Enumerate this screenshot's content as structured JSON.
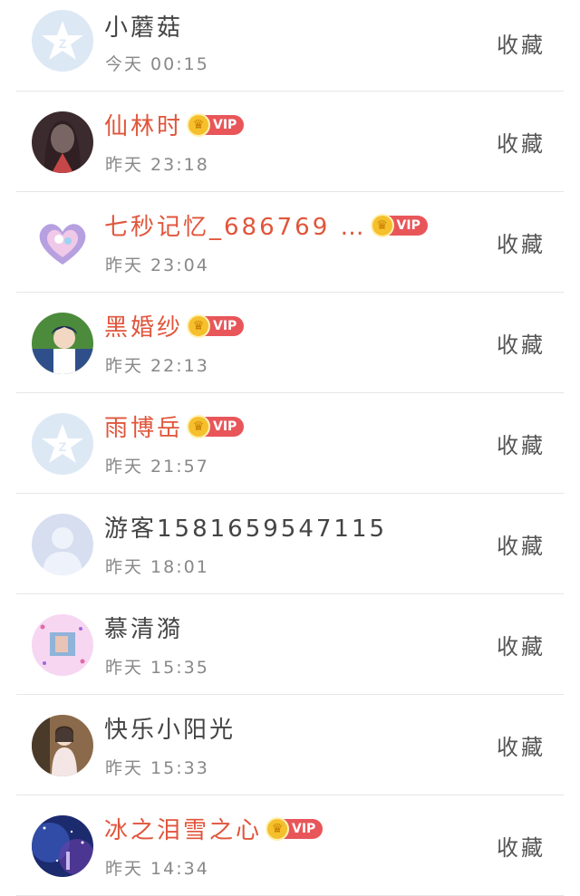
{
  "colors": {
    "vip_name": "#e0553b",
    "normal_name": "#444444",
    "vip_badge": "#e8565a",
    "crown": "#f5c02c"
  },
  "rows": [
    {
      "name": "小蘑菇",
      "time": "今天 00:15",
      "vip": false,
      "fav": "收藏",
      "avatar": "qzone-default-avatar"
    },
    {
      "name": "仙林时",
      "time": "昨天 23:18",
      "vip": true,
      "vip_label": "VIP",
      "fav": "收藏",
      "avatar": "girl-photo-avatar"
    },
    {
      "name": "七秒记忆_686769 …",
      "time": "昨天 23:04",
      "vip": true,
      "vip_label": "VIP",
      "fav": "收藏",
      "avatar": "heart-avatar"
    },
    {
      "name": "黑婚纱",
      "time": "昨天 22:13",
      "vip": true,
      "vip_label": "VIP",
      "fav": "收藏",
      "avatar": "anime-boy-avatar"
    },
    {
      "name": "雨博岳",
      "time": "昨天 21:57",
      "vip": true,
      "vip_label": "VIP",
      "fav": "收藏",
      "avatar": "qzone-default-avatar"
    },
    {
      "name": "游客1581659547115",
      "time": "昨天 18:01",
      "vip": false,
      "fav": "收藏",
      "avatar": "guest-silhouette-avatar"
    },
    {
      "name": "慕清漪",
      "time": "昨天 15:35",
      "vip": false,
      "fav": "收藏",
      "avatar": "pink-frame-avatar"
    },
    {
      "name": "快乐小阳光",
      "time": "昨天 15:33",
      "vip": false,
      "fav": "收藏",
      "avatar": "girl-room-avatar"
    },
    {
      "name": "冰之泪雪之心",
      "time": "昨天 14:34",
      "vip": true,
      "vip_label": "VIP",
      "fav": "收藏",
      "avatar": "starry-sky-avatar"
    }
  ]
}
